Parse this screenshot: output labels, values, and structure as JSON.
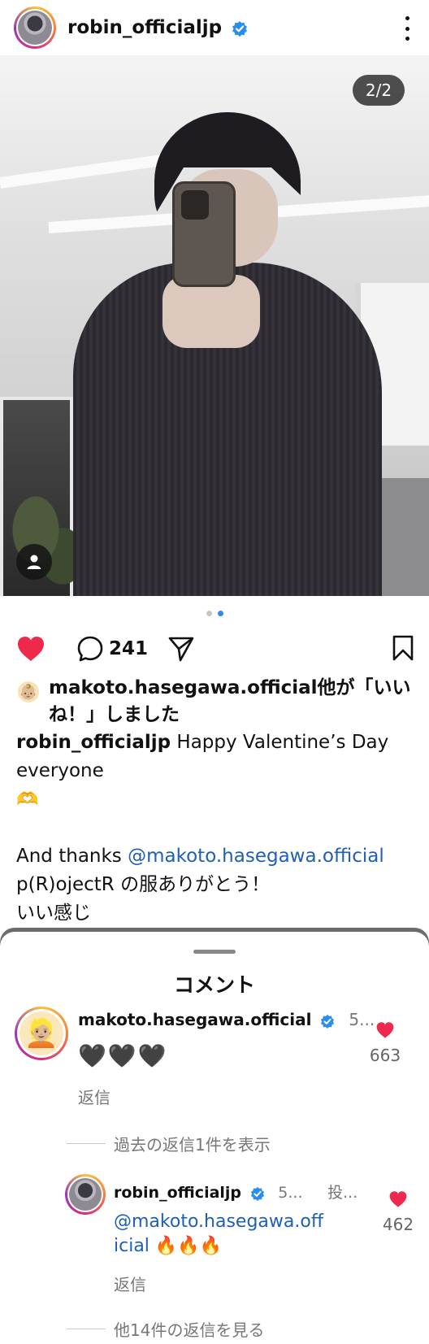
{
  "header": {
    "username": "robin_officialjp",
    "more_icon": "more-vertical-icon"
  },
  "photo": {
    "counter": "2/2",
    "tag_icon": "person-tag-icon",
    "carousel_active_index": 1,
    "carousel_count": 2
  },
  "actions": {
    "like_icon": "heart-filled-icon",
    "comment_icon": "comment-bubble-icon",
    "comment_count": "241",
    "share_icon": "send-icon",
    "save_icon": "bookmark-icon",
    "like_color": "#ed2a4c"
  },
  "likes": {
    "avatar_emoji": "👶🏼",
    "text": "makoto.hasegawa.official他が「いいね！」しました"
  },
  "caption": {
    "username": "robin_officialjp",
    "line1": " Happy Valentine’s Day everyone",
    "emoji": "🫶",
    "thanks_prefix": "And thanks ",
    "mention": "@makoto.hasegawa.official",
    "line3": "p(R)ojectR の服ありがとう！",
    "line4": "いい感じ"
  },
  "comments_sheet": {
    "title": "コメント",
    "comment": {
      "avatar_emoji": "👱🏼",
      "username": "makoto.hasegawa.official",
      "time": "5...",
      "body": "🖤🖤🖤",
      "reply_label": "返信",
      "like_count": "663"
    },
    "view_past": "過去の返信1件を表示",
    "reply": {
      "username": "robin_officialjp",
      "time": "5...",
      "status": "投...",
      "mention": "@makoto.hasegawa.official",
      "flames": "🔥🔥🔥",
      "reply_label": "返信",
      "like_count": "462"
    },
    "view_more": "他14件の返信を見る"
  }
}
